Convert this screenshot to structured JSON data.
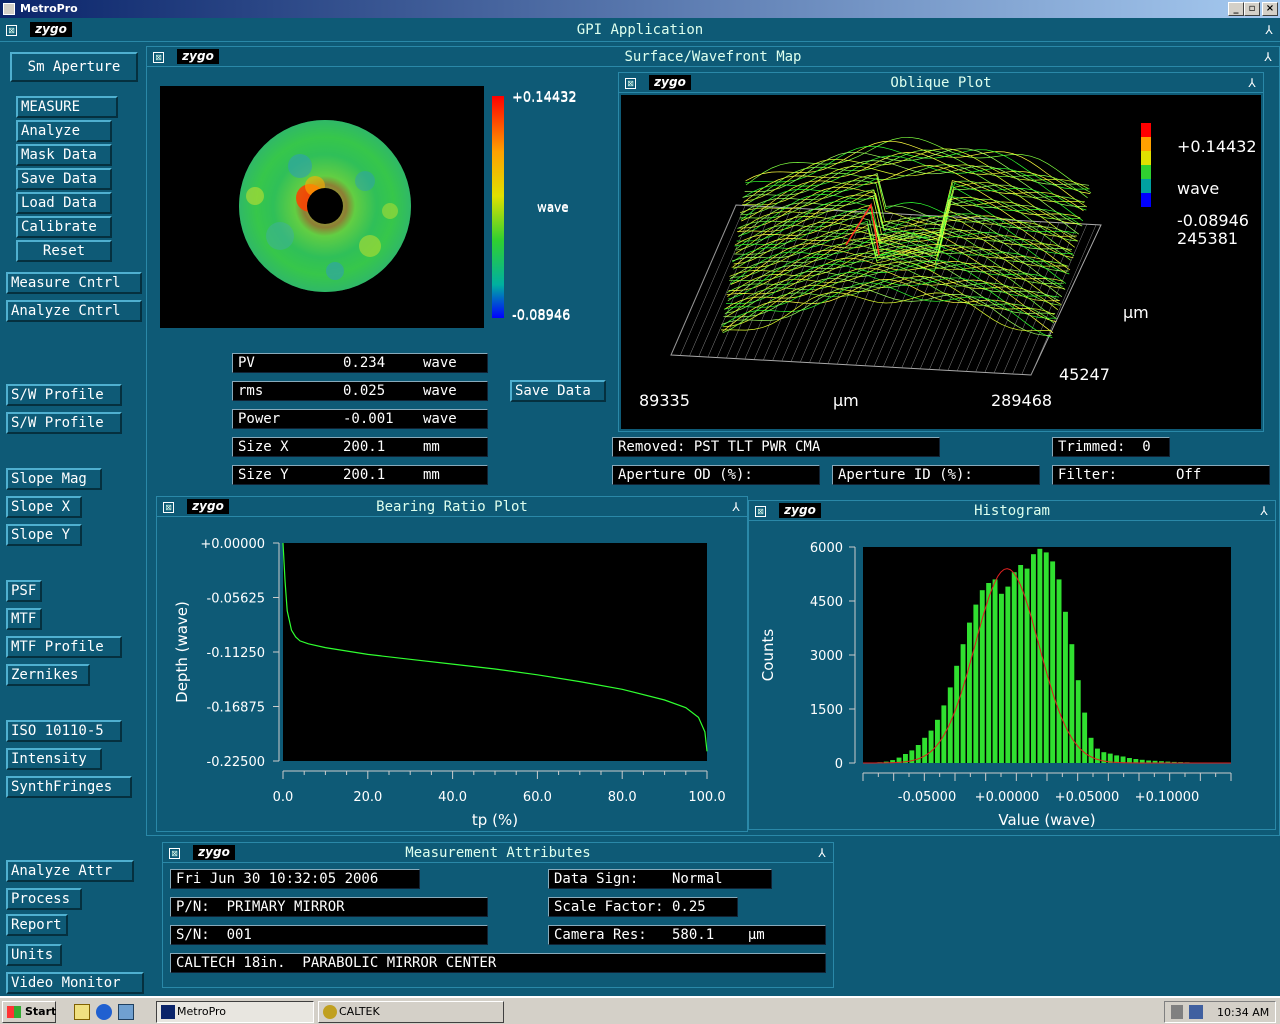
{
  "window": {
    "title": "MetroPro",
    "min": "_",
    "max": "▫",
    "close": "×"
  },
  "app": {
    "title": "GPI Application",
    "logo": "zygo",
    "close_icon": "⊠",
    "pin_icon": "⅄"
  },
  "sidebar": {
    "aperture": "Sm Aperture",
    "buttons": [
      "MEASURE",
      "Analyze",
      "Mask Data",
      "Save Data",
      "Load Data",
      "Calibrate",
      "Reset",
      "Measure Cntrl",
      "Analyze Cntrl",
      "S/W Profile",
      "S/W Profile",
      "Slope Mag",
      "Slope X",
      "Slope Y",
      "PSF",
      "MTF",
      "MTF Profile",
      "Zernikes",
      "ISO 10110-5",
      "Intensity",
      "SynthFringes",
      "Analyze Attr",
      "Process",
      "Report",
      "Units",
      "Video Monitor"
    ]
  },
  "surface": {
    "title": "Surface/Wavefront Map",
    "scale_max": "+0.14432",
    "scale_min": "-0.08946",
    "scale_unit": "wave",
    "results": [
      {
        "label": "PV",
        "value": "0.234",
        "unit": "wave"
      },
      {
        "label": "rms",
        "value": "0.025",
        "unit": "wave"
      },
      {
        "label": "Power",
        "value": "-0.001",
        "unit": "wave"
      },
      {
        "label": "Size X",
        "value": "200.1",
        "unit": "mm"
      },
      {
        "label": "Size Y",
        "value": "200.1",
        "unit": "mm"
      }
    ],
    "save_button": "Save Data",
    "removed": "Removed: PST TLT PWR CMA",
    "trimmed": "Trimmed:  0",
    "aperture_od": "Aperture OD (%):",
    "aperture_id": "Aperture ID (%):",
    "filter": "Filter:       Off"
  },
  "oblique": {
    "title": "Oblique Plot",
    "scale_max": "+0.14432",
    "unit": "wave",
    "scale_min": "-0.08946",
    "y_top": "245381",
    "y_unit": "µm",
    "y_bottom": "45247",
    "x_left": "89335",
    "x_unit": "µm",
    "x_right": "289468"
  },
  "bearing": {
    "title": "Bearing Ratio Plot",
    "chart_data": {
      "type": "line",
      "xlabel": "tp (%)",
      "ylabel": "Depth (wave)",
      "xlim": [
        0,
        100
      ],
      "ylim": [
        -0.225,
        0
      ],
      "x_ticks": [
        "0.0",
        "20.0",
        "40.0",
        "60.0",
        "80.0",
        "100.0"
      ],
      "y_ticks": [
        "+0.00000",
        "-0.05625",
        "-0.11250",
        "-0.16875",
        "-0.22500"
      ],
      "series": [
        {
          "x": [
            0,
            0.5,
            1,
            2,
            3,
            4,
            6,
            10,
            20,
            30,
            40,
            50,
            60,
            70,
            80,
            90,
            95,
            98,
            99.5,
            100
          ],
          "y": [
            0,
            -0.04,
            -0.07,
            -0.09,
            -0.097,
            -0.101,
            -0.104,
            -0.108,
            -0.115,
            -0.12,
            -0.125,
            -0.13,
            -0.136,
            -0.143,
            -0.151,
            -0.162,
            -0.17,
            -0.18,
            -0.195,
            -0.215
          ]
        }
      ]
    }
  },
  "histogram": {
    "title": "Histogram",
    "chart_data": {
      "type": "bar",
      "xlabel": "Value (wave)",
      "ylabel": "Counts",
      "xlim": [
        -0.09,
        0.14
      ],
      "ylim": [
        0,
        6000
      ],
      "x_ticks": [
        "-0.05000",
        "+0.00000",
        "+0.05000",
        "+0.10000"
      ],
      "y_ticks": [
        "0",
        "1500",
        "3000",
        "4500",
        "6000"
      ],
      "bin_start": -0.085,
      "bin_width": 0.004,
      "values": [
        10,
        20,
        40,
        80,
        150,
        250,
        350,
        500,
        700,
        900,
        1200,
        1600,
        2100,
        2700,
        3300,
        3900,
        4400,
        4800,
        5000,
        5100,
        4700,
        4900,
        5300,
        5500,
        5400,
        5800,
        5950,
        5850,
        5600,
        5100,
        4200,
        3300,
        2300,
        1400,
        700,
        400,
        300,
        260,
        210,
        180,
        140,
        110,
        90,
        70,
        60,
        50,
        40,
        30,
        25,
        20,
        15,
        10,
        10,
        5,
        5
      ],
      "fit": {
        "mean": 0.0,
        "sigma": 0.02,
        "peak": 5400
      }
    }
  },
  "attributes": {
    "title": "Measurement Attributes",
    "date": "Fri Jun 30 10:32:05 2006",
    "pn": "P/N:  PRIMARY MIRROR",
    "sn": "S/N:  001",
    "description": "CALTECH 18in.  PARABOLIC MIRROR CENTER",
    "data_sign": "Data Sign:    Normal",
    "scale_factor": "Scale Factor: 0.25",
    "camera_res": "Camera Res:   580.1    µm"
  },
  "taskbar": {
    "start": "Start",
    "task1": "MetroPro",
    "task2": "CALTEK",
    "clock": "10:34 AM"
  }
}
